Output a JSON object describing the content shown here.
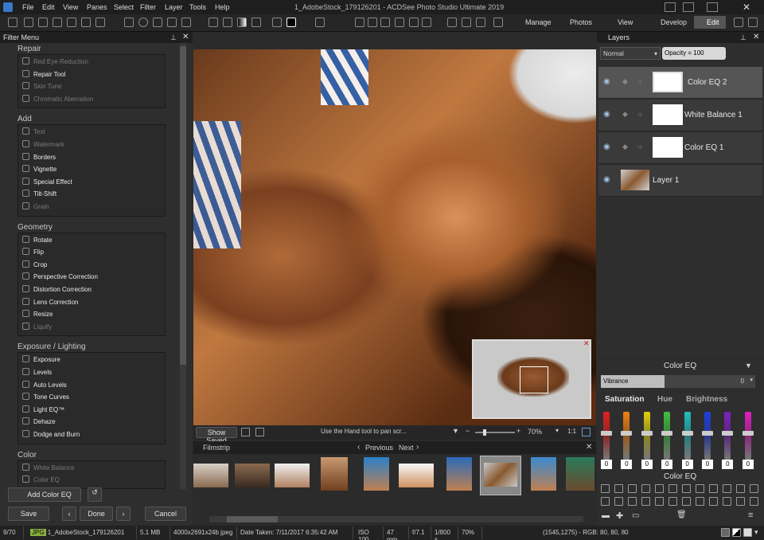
{
  "window": {
    "title": "1_AdobeStock_179126201 - ACDSee Photo Studio Ultimate 2019"
  },
  "menu": [
    "File",
    "Edit",
    "View",
    "Panes",
    "Select",
    "Filter",
    "Layer",
    "Tools",
    "Help"
  ],
  "modes": [
    "Manage",
    "Photos",
    "View",
    "Develop",
    "Edit"
  ],
  "filter_menu": {
    "title": "Filter Menu",
    "groups": [
      {
        "label": "Repair",
        "items": [
          {
            "label": "Red Eye Reduction",
            "enabled": false
          },
          {
            "label": "Repair Tool",
            "enabled": true
          },
          {
            "label": "Skin Tune",
            "enabled": false
          },
          {
            "label": "Chromatic Aberration",
            "enabled": false
          }
        ]
      },
      {
        "label": "Add",
        "items": [
          {
            "label": "Text",
            "enabled": false
          },
          {
            "label": "Watermark",
            "enabled": false
          },
          {
            "label": "Borders",
            "enabled": true
          },
          {
            "label": "Vignette",
            "enabled": true
          },
          {
            "label": "Special Effect",
            "enabled": true
          },
          {
            "label": "Tilt-Shift",
            "enabled": true
          },
          {
            "label": "Grain",
            "enabled": false
          }
        ]
      },
      {
        "label": "Geometry",
        "items": [
          {
            "label": "Rotate",
            "enabled": true
          },
          {
            "label": "Flip",
            "enabled": true
          },
          {
            "label": "Crop",
            "enabled": true
          },
          {
            "label": "Perspective Correction",
            "enabled": true
          },
          {
            "label": "Distortion Correction",
            "enabled": true
          },
          {
            "label": "Lens Correction",
            "enabled": true
          },
          {
            "label": "Resize",
            "enabled": true
          },
          {
            "label": "Liquify",
            "enabled": false
          }
        ]
      },
      {
        "label": "Exposure / Lighting",
        "items": [
          {
            "label": "Exposure",
            "enabled": true
          },
          {
            "label": "Levels",
            "enabled": true
          },
          {
            "label": "Auto Levels",
            "enabled": true
          },
          {
            "label": "Tone Curves",
            "enabled": true
          },
          {
            "label": "Light EQ™",
            "enabled": true
          },
          {
            "label": "Dehaze",
            "enabled": true
          },
          {
            "label": "Dodge and Burn",
            "enabled": true
          }
        ]
      },
      {
        "label": "Color",
        "items": [
          {
            "label": "White Balance",
            "enabled": false
          },
          {
            "label": "Color EQ",
            "enabled": false
          }
        ]
      }
    ],
    "add_color_eq": "Add Color EQ",
    "save": "Save",
    "done": "Done",
    "cancel": "Cancel"
  },
  "image_bar": {
    "show_saved": "Show Saved",
    "hint": "Use the Hand tool to pan scr...",
    "zoom": "70%",
    "ratio": "1:1"
  },
  "filmstrip": {
    "title": "Filmstrip",
    "previous": "Previous",
    "next": "Next"
  },
  "layers": {
    "title": "Layers",
    "blend": "Normal",
    "opacity": "Opacity = 100",
    "items": [
      {
        "name": "Color EQ 2"
      },
      {
        "name": "White Balance 1"
      },
      {
        "name": "Color EQ 1"
      },
      {
        "name": "Layer 1"
      }
    ]
  },
  "color_eq": {
    "title": "Color EQ",
    "dropdown": "Vibrance",
    "value": "0",
    "tabs": [
      "Saturation",
      "Hue",
      "Brightness"
    ],
    "slider_colors": [
      "#e02020",
      "#f08010",
      "#e0d010",
      "#40c040",
      "#20c0c0",
      "#2040e0",
      "#8020c0",
      "#e020c0"
    ],
    "values": [
      "0",
      "0",
      "0",
      "0",
      "0",
      "0",
      "0",
      "0"
    ],
    "tools_title": "Color EQ"
  },
  "status": {
    "count": "9/70",
    "type": "JPG",
    "file": "1_AdobeStock_179126201",
    "size": "5.1 MB",
    "dims": "4000x2691x24b jpeg",
    "date": "Date Taken: 7/11/2017 6:35:42 AM",
    "iso": "ISO 100",
    "focal": "47 mm",
    "fstop": "f/7.1",
    "shutter": "1/800 s",
    "zoom": "70%",
    "rgb": "(1545,1275) - RGB: 80, 80, 80"
  }
}
